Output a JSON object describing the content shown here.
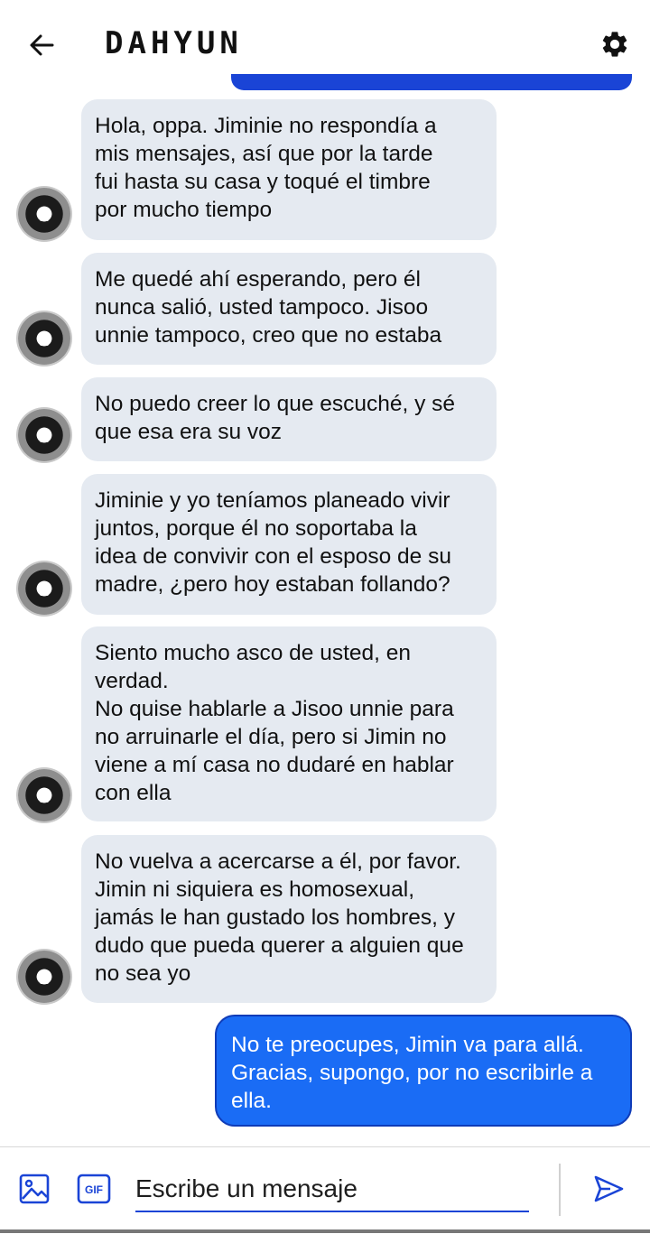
{
  "header": {
    "title": "DAHYUN",
    "back_icon": "arrow-left-icon",
    "settings_icon": "gear-icon"
  },
  "messages": [
    {
      "direction": "in",
      "text": "Hola, oppa. Jiminie no respondía a\nmis mensajes, así que por la tarde\nfui hasta su casa y toqué el timbre\npor mucho tiempo"
    },
    {
      "direction": "in",
      "text": "Me quedé ahí esperando, pero él\nnunca salió, usted tampoco. Jisoo\nunnie tampoco, creo que no estaba"
    },
    {
      "direction": "in",
      "text": "No puedo creer lo que escuché, y sé\nque esa era su voz"
    },
    {
      "direction": "in",
      "text": "Jiminie y yo teníamos planeado vivir\njuntos, porque él no soportaba la\nidea de convivir con el esposo de su\nmadre, ¿pero hoy estaban follando?"
    },
    {
      "direction": "in",
      "text": "Siento mucho asco de usted, en\nverdad.\nNo quise hablarle a Jisoo unnie para\nno arruinarle el día, pero si Jimin no\nviene a mí casa no dudaré en hablar\ncon ella"
    },
    {
      "direction": "in",
      "text": "No vuelva a acercarse a él, por favor.\nJimin ni siquiera es homosexual,\njamás le han gustado los hombres, y\ndudo que pueda querer a alguien que\nno sea yo"
    },
    {
      "direction": "out",
      "text": "No te preocupes, Jimin va para allá.\nGracias, supongo, por no escribirle a\nella."
    }
  ],
  "composer": {
    "placeholder": "Escribe un mensaje",
    "image_icon": "image-icon",
    "gif_label": "GIF",
    "send_icon": "send-icon"
  },
  "colors": {
    "accent": "#1a44d6",
    "outgoing_bubble": "#1a6cf5",
    "incoming_bubble": "#e5eaf1"
  }
}
